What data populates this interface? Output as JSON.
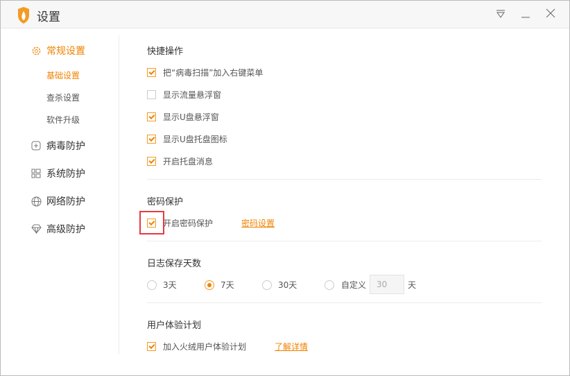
{
  "window": {
    "title": "设置",
    "accent": "#f08300"
  },
  "sidebar": {
    "items": [
      {
        "label": "常规设置",
        "icon": "gear-icon",
        "active": true,
        "children": [
          {
            "label": "基础设置",
            "active": true
          },
          {
            "label": "查杀设置"
          },
          {
            "label": "软件升级"
          }
        ]
      },
      {
        "label": "病毒防护",
        "icon": "plus-box-icon"
      },
      {
        "label": "系统防护",
        "icon": "grid-icon"
      },
      {
        "label": "网络防护",
        "icon": "globe-icon"
      },
      {
        "label": "高级防护",
        "icon": "diamond-icon"
      }
    ]
  },
  "sections": {
    "shortcut": {
      "title": "快捷操作",
      "options": [
        {
          "label": "把“病毒扫描”加入右键菜单",
          "checked": true
        },
        {
          "label": "显示流量悬浮窗",
          "checked": false
        },
        {
          "label": "显示U盘悬浮窗",
          "checked": true
        },
        {
          "label": "显示U盘托盘图标",
          "checked": true
        },
        {
          "label": "开启托盘消息",
          "checked": true
        }
      ]
    },
    "password": {
      "title": "密码保护",
      "option": {
        "label": "开启密码保护",
        "checked": true
      },
      "link": "密码设置"
    },
    "log": {
      "title": "日志保存天数",
      "options": [
        "3天",
        "7天",
        "30天",
        "自定义"
      ],
      "selected": "7天",
      "custom_value": "30",
      "unit": "天"
    },
    "ux": {
      "title": "用户体验计划",
      "option": {
        "label": "加入火绒用户体验计划",
        "checked": true
      },
      "link": "了解详情"
    }
  }
}
